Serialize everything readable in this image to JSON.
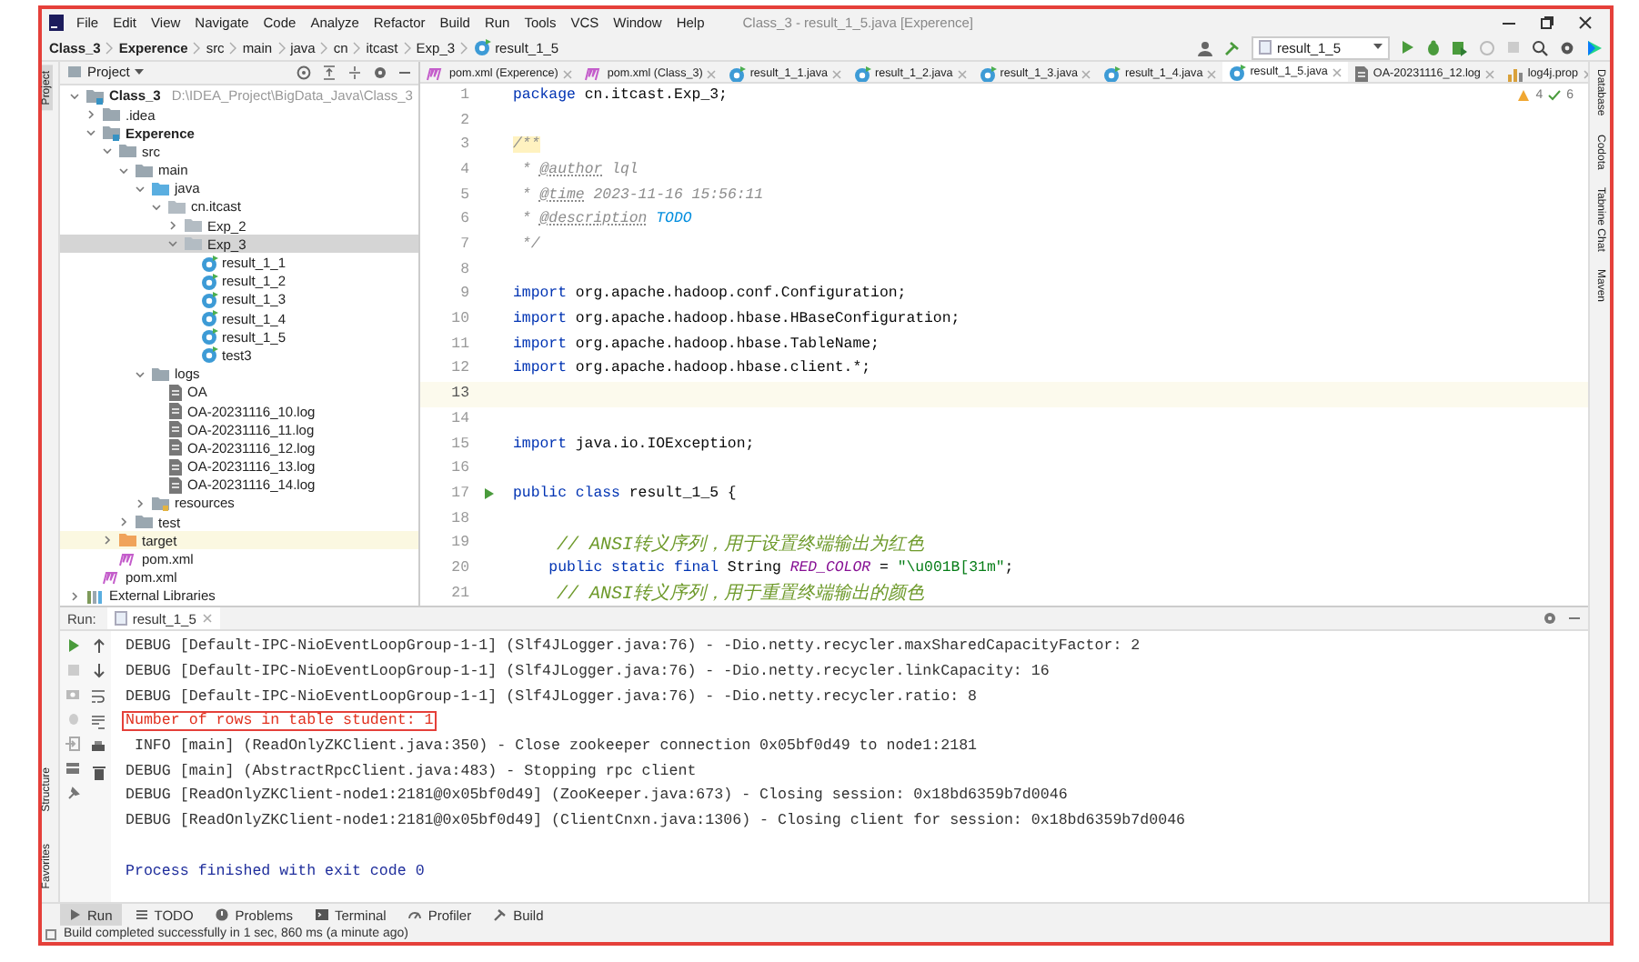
{
  "window": {
    "title": "Class_3 - result_1_5.java [Experence]"
  },
  "menu": [
    "File",
    "Edit",
    "View",
    "Navigate",
    "Code",
    "Analyze",
    "Refactor",
    "Build",
    "Run",
    "Tools",
    "VCS",
    "Window",
    "Help"
  ],
  "breadcrumb": [
    {
      "label": "Class_3",
      "kind": "module"
    },
    {
      "label": "Experence",
      "kind": "module"
    },
    {
      "label": "src",
      "kind": "dir"
    },
    {
      "label": "main",
      "kind": "dir"
    },
    {
      "label": "java",
      "kind": "dir"
    },
    {
      "label": "cn",
      "kind": "dir"
    },
    {
      "label": "itcast",
      "kind": "dir"
    },
    {
      "label": "Exp_3",
      "kind": "dir"
    },
    {
      "label": "result_1_5",
      "kind": "class"
    }
  ],
  "toolbar": {
    "run_config": "result_1_5"
  },
  "left_strip": {
    "top": [
      {
        "label": "Project",
        "selected": true
      }
    ],
    "bottom": [
      {
        "label": "Structure",
        "selected": false
      },
      {
        "label": "Favorites",
        "selected": false
      }
    ]
  },
  "right_strip": [
    "Database",
    "Codota",
    "Tabnine Chat",
    "Maven"
  ],
  "project_panel": {
    "title": "Project",
    "tree": [
      {
        "label": "Class_3",
        "path": "D:\\IDEA_Project\\BigData_Java\\Class_3",
        "kind": "module",
        "expanded": true,
        "selected": false,
        "children": [
          {
            "label": ".idea",
            "kind": "folder",
            "expanded": false,
            "selected": false
          },
          {
            "label": "Experence",
            "kind": "module",
            "expanded": true,
            "selected": false,
            "children": [
              {
                "label": "src",
                "kind": "folder",
                "expanded": true,
                "selected": false,
                "children": [
                  {
                    "label": "main",
                    "kind": "folder",
                    "expanded": true,
                    "selected": false,
                    "children": [
                      {
                        "label": "java",
                        "kind": "source-folder",
                        "expanded": true,
                        "selected": false,
                        "children": [
                          {
                            "label": "cn.itcast",
                            "kind": "package",
                            "expanded": true,
                            "selected": false,
                            "children": [
                              {
                                "label": "Exp_2",
                                "kind": "package",
                                "expanded": false,
                                "selected": false
                              },
                              {
                                "label": "Exp_3",
                                "kind": "package",
                                "expanded": true,
                                "selected": true,
                                "children": [
                                  {
                                    "label": "result_1_1",
                                    "kind": "class",
                                    "selected": false
                                  },
                                  {
                                    "label": "result_1_2",
                                    "kind": "class",
                                    "selected": false
                                  },
                                  {
                                    "label": "result_1_3",
                                    "kind": "class",
                                    "selected": false
                                  },
                                  {
                                    "label": "result_1_4",
                                    "kind": "class",
                                    "selected": false
                                  },
                                  {
                                    "label": "result_1_5",
                                    "kind": "class",
                                    "selected": false
                                  },
                                  {
                                    "label": "test3",
                                    "kind": "class",
                                    "selected": false
                                  }
                                ]
                              }
                            ]
                          }
                        ]
                      },
                      {
                        "label": "logs",
                        "kind": "folder",
                        "expanded": true,
                        "selected": false,
                        "children": [
                          {
                            "label": "OA",
                            "kind": "log",
                            "selected": false
                          },
                          {
                            "label": "OA-20231116_10.log",
                            "kind": "log",
                            "selected": false
                          },
                          {
                            "label": "OA-20231116_11.log",
                            "kind": "log",
                            "selected": false
                          },
                          {
                            "label": "OA-20231116_12.log",
                            "kind": "log",
                            "selected": false
                          },
                          {
                            "label": "OA-20231116_13.log",
                            "kind": "log",
                            "selected": false
                          },
                          {
                            "label": "OA-20231116_14.log",
                            "kind": "log",
                            "selected": false
                          }
                        ]
                      },
                      {
                        "label": "resources",
                        "kind": "resource-folder",
                        "expanded": false,
                        "selected": false
                      }
                    ]
                  },
                  {
                    "label": "test",
                    "kind": "folder",
                    "expanded": false,
                    "selected": false
                  }
                ]
              },
              {
                "label": "target",
                "kind": "excluded-folder",
                "expanded": false,
                "selected": false
              },
              {
                "label": "pom.xml",
                "kind": "maven",
                "selected": false
              }
            ]
          },
          {
            "label": "pom.xml",
            "kind": "maven",
            "selected": false
          }
        ]
      },
      {
        "label": "External Libraries",
        "kind": "library",
        "expanded": false,
        "selected": false
      }
    ]
  },
  "editor_tabs": [
    {
      "label": "pom.xml (Experence)",
      "kind": "maven",
      "selected": false
    },
    {
      "label": "pom.xml (Class_3)",
      "kind": "maven",
      "selected": false
    },
    {
      "label": "result_1_1.java",
      "kind": "class",
      "selected": false
    },
    {
      "label": "result_1_2.java",
      "kind": "class",
      "selected": false
    },
    {
      "label": "result_1_3.java",
      "kind": "class",
      "selected": false
    },
    {
      "label": "result_1_4.java",
      "kind": "class",
      "selected": false
    },
    {
      "label": "result_1_5.java",
      "kind": "class",
      "selected": true
    },
    {
      "label": "OA-20231116_12.log",
      "kind": "log",
      "selected": false
    },
    {
      "label": "log4j.prop",
      "kind": "properties",
      "selected": false
    }
  ],
  "editor": {
    "inspections": {
      "warnings": "4",
      "ok": "6"
    },
    "lines": [
      {
        "number": "1",
        "current": false,
        "tokens": [
          {
            "kind": "kw",
            "text": "package"
          },
          {
            "kind": "plain",
            "text": " cn.itcast.Exp_3;"
          }
        ]
      },
      {
        "number": "2",
        "current": false
      },
      {
        "number": "3",
        "current": false,
        "tokens": [
          {
            "kind": "doc-start",
            "text": "/**"
          }
        ]
      },
      {
        "number": "4",
        "current": false,
        "tokens": [
          {
            "kind": "doc",
            "text": " * "
          },
          {
            "kind": "doc-tag",
            "text": "@author"
          },
          {
            "kind": "doc",
            "text": " lql"
          }
        ]
      },
      {
        "number": "5",
        "current": false,
        "tokens": [
          {
            "kind": "doc",
            "text": " * "
          },
          {
            "kind": "doc-tag",
            "text": "@time"
          },
          {
            "kind": "doc",
            "text": " 2023-11-16 15:56:11"
          }
        ]
      },
      {
        "number": "6",
        "current": false,
        "tokens": [
          {
            "kind": "doc",
            "text": " * "
          },
          {
            "kind": "doc-tag",
            "text": "@description"
          },
          {
            "kind": "todo",
            "text": " TODO"
          }
        ]
      },
      {
        "number": "7",
        "current": false,
        "tokens": [
          {
            "kind": "doc",
            "text": " */"
          }
        ]
      },
      {
        "number": "8",
        "current": false
      },
      {
        "number": "9",
        "current": false,
        "tokens": [
          {
            "kind": "kw",
            "text": "import"
          },
          {
            "kind": "plain",
            "text": " org.apache.hadoop.conf.Configuration;"
          }
        ]
      },
      {
        "number": "10",
        "current": false,
        "tokens": [
          {
            "kind": "kw",
            "text": "import"
          },
          {
            "kind": "plain",
            "text": " org.apache.hadoop.hbase.HBaseConfiguration;"
          }
        ]
      },
      {
        "number": "11",
        "current": false,
        "tokens": [
          {
            "kind": "kw",
            "text": "import"
          },
          {
            "kind": "plain",
            "text": " org.apache.hadoop.hbase.TableName;"
          }
        ]
      },
      {
        "number": "12",
        "current": false,
        "tokens": [
          {
            "kind": "kw",
            "text": "import"
          },
          {
            "kind": "plain",
            "text": " org.apache.hadoop.hbase.client.*;"
          }
        ]
      },
      {
        "number": "13",
        "current": true
      },
      {
        "number": "14",
        "current": false
      },
      {
        "number": "15",
        "current": false,
        "tokens": [
          {
            "kind": "kw",
            "text": "import"
          },
          {
            "kind": "plain",
            "text": " java.io.IOException;"
          }
        ]
      },
      {
        "number": "16",
        "current": false
      },
      {
        "number": "17",
        "current": false,
        "runnable": true,
        "tokens": [
          {
            "kind": "kw",
            "text": "public class"
          },
          {
            "kind": "plain",
            "text": " result_1_5 {"
          }
        ]
      },
      {
        "number": "18",
        "current": false
      },
      {
        "number": "19",
        "current": false,
        "tokens": [
          {
            "kind": "comment",
            "text": "    // ANSI转义序列，用于设置终端输出为红色"
          }
        ]
      },
      {
        "number": "20",
        "current": false,
        "tokens": [
          {
            "kind": "kw",
            "text": "    public static final"
          },
          {
            "kind": "plain",
            "text": " String "
          },
          {
            "kind": "const",
            "text": "RED_COLOR"
          },
          {
            "kind": "plain",
            "text": " = "
          },
          {
            "kind": "str",
            "text": "\"\\u001B[31m\""
          },
          {
            "kind": "plain",
            "text": ";"
          }
        ]
      },
      {
        "number": "21",
        "current": false,
        "tokens": [
          {
            "kind": "comment",
            "text": "    // ANSI转义序列，用于重置终端输出的颜色"
          }
        ]
      }
    ]
  },
  "run_panel": {
    "title": "Run:",
    "tab": "result_1_5",
    "console": [
      {
        "kind": "debug",
        "text": "DEBUG [Default-IPC-NioEventLoopGroup-1-1] (Slf4JLogger.java:76) - -Dio.netty.recycler.maxSharedCapacityFactor: 2"
      },
      {
        "kind": "debug",
        "text": "DEBUG [Default-IPC-NioEventLoopGroup-1-1] (Slf4JLogger.java:76) - -Dio.netty.recycler.linkCapacity: 16"
      },
      {
        "kind": "debug",
        "text": "DEBUG [Default-IPC-NioEventLoopGroup-1-1] (Slf4JLogger.java:76) - -Dio.netty.recycler.ratio: 8"
      },
      {
        "kind": "error",
        "text": "Number of rows in table student: 1",
        "boxed": true
      },
      {
        "kind": "info",
        "text": " INFO [main] (ReadOnlyZKClient.java:350) - Close zookeeper connection 0x05bf0d49 to node1:2181"
      },
      {
        "kind": "debug",
        "text": "DEBUG [main] (AbstractRpcClient.java:483) - Stopping rpc client"
      },
      {
        "kind": "debug",
        "text": "DEBUG [ReadOnlyZKClient-node1:2181@0x05bf0d49] (ZooKeeper.java:673) - Closing session: 0x18bd6359b7d0046"
      },
      {
        "kind": "debug",
        "text": "DEBUG [ReadOnlyZKClient-node1:2181@0x05bf0d49] (ClientCnxn.java:1306) - Closing client for session: 0x18bd6359b7d0046"
      },
      {
        "kind": "blank"
      },
      {
        "kind": "system",
        "text": "Process finished with exit code 0"
      }
    ]
  },
  "bottom_tabs": [
    {
      "label": "Run",
      "kind": "run",
      "selected": true
    },
    {
      "label": "TODO",
      "kind": "todo",
      "selected": false
    },
    {
      "label": "Problems",
      "kind": "problems",
      "selected": false
    },
    {
      "label": "Terminal",
      "kind": "terminal",
      "selected": false
    },
    {
      "label": "Profiler",
      "kind": "profiler",
      "selected": false
    },
    {
      "label": "Build",
      "kind": "build",
      "selected": false
    }
  ],
  "status_bar": {
    "message": "Build completed successfully in 1 sec, 860 ms (a minute ago)"
  }
}
